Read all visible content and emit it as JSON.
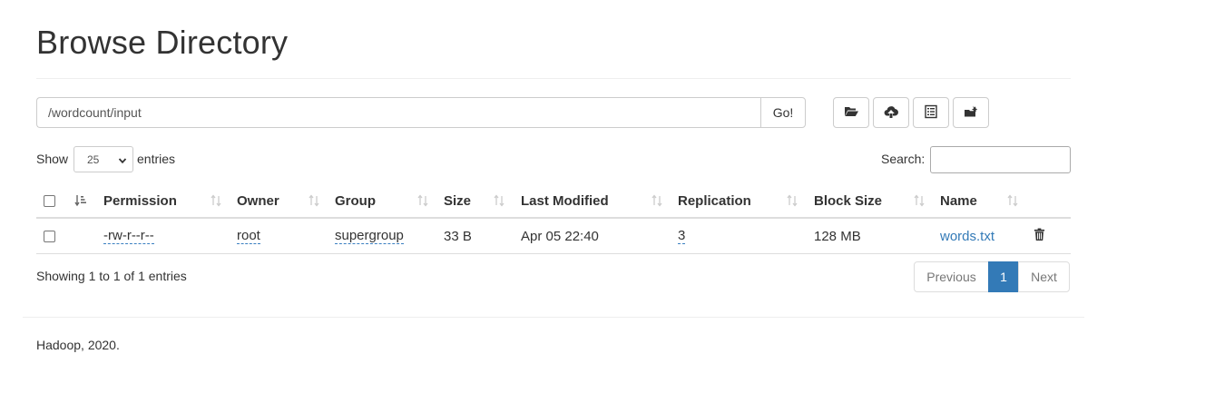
{
  "page": {
    "title": "Browse Directory"
  },
  "path_bar": {
    "value": "/wordcount/input",
    "go_label": "Go!"
  },
  "toolbar": {
    "buttons": [
      {
        "icon": "folder-open-icon"
      },
      {
        "icon": "cloud-upload-icon"
      },
      {
        "icon": "list-alt-icon"
      },
      {
        "icon": "cut-icon"
      }
    ]
  },
  "length_menu": {
    "show_label": "Show",
    "selected": "25",
    "entries_label": "entries"
  },
  "search": {
    "label": "Search:",
    "value": ""
  },
  "table": {
    "headers": {
      "permission": "Permission",
      "owner": "Owner",
      "group": "Group",
      "size": "Size",
      "last_modified": "Last Modified",
      "replication": "Replication",
      "block_size": "Block Size",
      "name": "Name"
    },
    "rows": [
      {
        "permission": "-rw-r--r--",
        "owner": "root",
        "group": "supergroup",
        "size": "33 B",
        "last_modified": "Apr 05 22:40",
        "replication": "3",
        "block_size": "128 MB",
        "name": "words.txt"
      }
    ]
  },
  "info": {
    "text": "Showing 1 to 1 of 1 entries"
  },
  "pagination": {
    "previous": "Previous",
    "current": "1",
    "next": "Next"
  },
  "footer": {
    "text": "Hadoop, 2020."
  },
  "colors": {
    "link": "#337ab7",
    "active_page": "#337ab7",
    "border": "#cccccc"
  }
}
